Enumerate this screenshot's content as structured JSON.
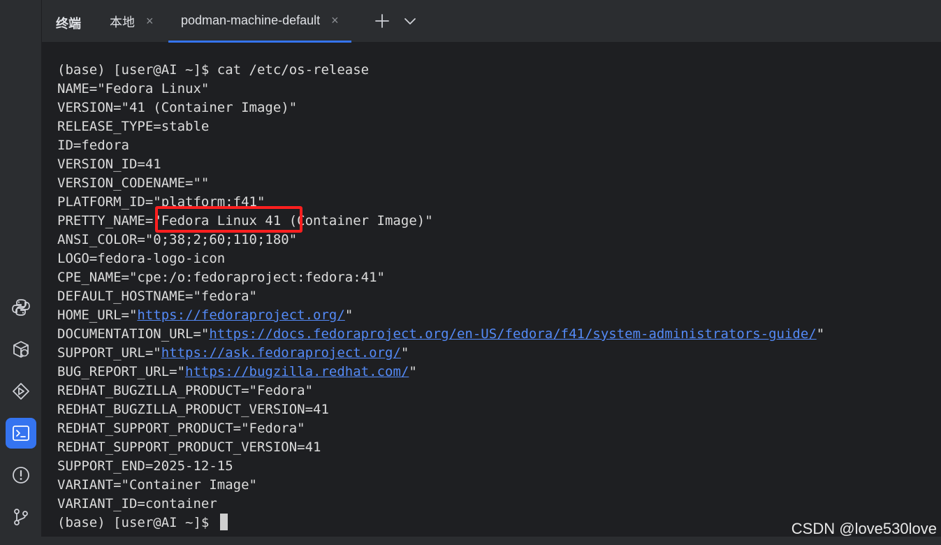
{
  "tabbar": {
    "title": "终端",
    "tabs": [
      {
        "label": "本地",
        "close": "×"
      },
      {
        "label": "podman-machine-default",
        "close": "×"
      }
    ],
    "new_tab_icon": "plus-icon",
    "dropdown_icon": "chevron-down-icon"
  },
  "sidebar": {
    "items": [
      {
        "name": "python-console",
        "icon": "python-icon"
      },
      {
        "name": "python-packages",
        "icon": "python-packages-icon"
      },
      {
        "name": "services",
        "icon": "run-services-icon"
      },
      {
        "name": "terminal",
        "icon": "terminal-icon",
        "active": true
      },
      {
        "name": "problems",
        "icon": "problems-icon"
      },
      {
        "name": "git",
        "icon": "git-branch-icon"
      }
    ]
  },
  "terminal": {
    "lines": [
      {
        "text": "(base) [user@AI ~]$ cat /etc/os-release"
      },
      {
        "text": "NAME=\"Fedora Linux\""
      },
      {
        "text": "VERSION=\"41 (Container Image)\""
      },
      {
        "text": "RELEASE_TYPE=stable"
      },
      {
        "text": "ID=fedora"
      },
      {
        "text": "VERSION_ID=41"
      },
      {
        "text": "VERSION_CODENAME=\"\""
      },
      {
        "text": "PLATFORM_ID=\"platform:f41\""
      },
      {
        "text": "PRETTY_NAME=\"Fedora Linux 41 (Container Image)\""
      },
      {
        "text": "ANSI_COLOR=\"0;38;2;60;110;180\""
      },
      {
        "text": "LOGO=fedora-logo-icon"
      },
      {
        "text": "CPE_NAME=\"cpe:/o:fedoraproject:fedora:41\""
      },
      {
        "text": "DEFAULT_HOSTNAME=\"fedora\""
      },
      {
        "prefix": "HOME_URL=\"",
        "link": "https://fedoraproject.org/",
        "suffix": "\""
      },
      {
        "prefix": "DOCUMENTATION_URL=\"",
        "link": "https://docs.fedoraproject.org/en-US/fedora/f41/system-administrators-guide/",
        "suffix": "\""
      },
      {
        "prefix": "SUPPORT_URL=\"",
        "link": "https://ask.fedoraproject.org/",
        "suffix": "\""
      },
      {
        "prefix": "BUG_REPORT_URL=\"",
        "link": "https://bugzilla.redhat.com/",
        "suffix": "\""
      },
      {
        "text": "REDHAT_BUGZILLA_PRODUCT=\"Fedora\""
      },
      {
        "text": "REDHAT_BUGZILLA_PRODUCT_VERSION=41"
      },
      {
        "text": "REDHAT_SUPPORT_PRODUCT=\"Fedora\""
      },
      {
        "text": "REDHAT_SUPPORT_PRODUCT_VERSION=41"
      },
      {
        "text": "SUPPORT_END=2025-12-15"
      },
      {
        "text": "VARIANT=\"Container Image\""
      },
      {
        "text": "VARIANT_ID=container"
      },
      {
        "text": "(base) [user@AI ~]$ ",
        "cursor": true
      }
    ]
  },
  "annotation": {
    "color": "#ff1f1f"
  },
  "watermark": "CSDN @love530love",
  "colors": {
    "background": "#1e1f22",
    "panel": "#2b2d30",
    "accent": "#3574f0",
    "link": "#548af7",
    "text": "#dcdcdc"
  }
}
